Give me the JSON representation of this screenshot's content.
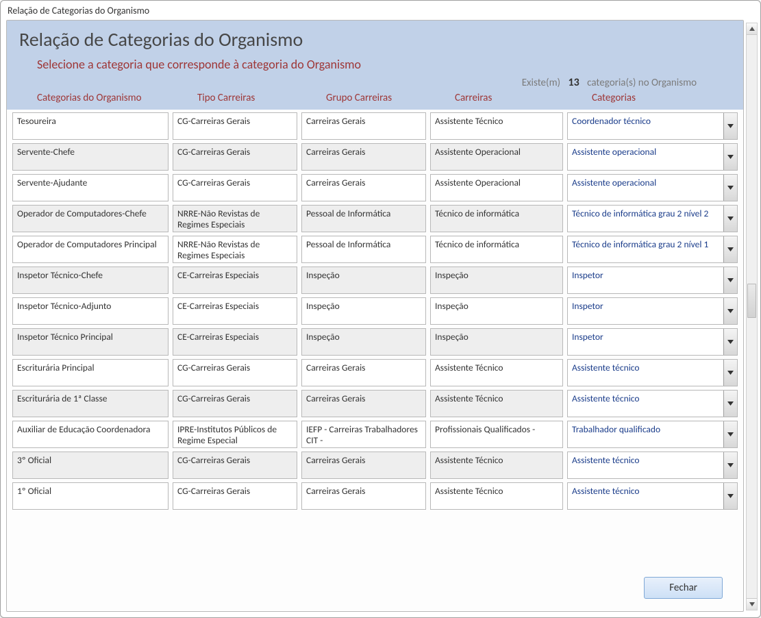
{
  "window_title": "Relação de Categorias do Organismo",
  "page_title": "Relação de Categorias do Organismo",
  "instruction": "Selecione a categoria que corresponde à categoria do Organismo",
  "count_prefix": "Existe(m)",
  "count_value": "13",
  "count_suffix": "categoria(s) no Organismo",
  "columns": {
    "c1": "Categorias do Organismo",
    "c2": "Tipo Carreiras",
    "c3": "Grupo Carreiras",
    "c4": "Carreiras",
    "c5": "Categorias"
  },
  "close_label": "Fechar",
  "rows": [
    {
      "org": "Tesoureira",
      "tipo": "CG-Carreiras Gerais",
      "grupo": "Carreiras Gerais",
      "carr": "Assistente Técnico",
      "cat": "Coordenador técnico",
      "white": true
    },
    {
      "org": "Servente-Chefe",
      "tipo": "CG-Carreiras Gerais",
      "grupo": "Carreiras Gerais",
      "carr": "Assistente Operacional",
      "cat": "Assistente operacional"
    },
    {
      "org": "Servente-Ajudante",
      "tipo": "CG-Carreiras Gerais",
      "grupo": "Carreiras Gerais",
      "carr": "Assistente Operacional",
      "cat": "Assistente operacional",
      "white": true
    },
    {
      "org": "Operador de Computadores-Chefe",
      "tipo": "NRRE-Não Revistas de Regimes Especiais",
      "grupo": "Pessoal de Informática",
      "carr": "Técnico de informática",
      "cat": "Técnico de informática grau 2 nível 2"
    },
    {
      "org": "Operador de Computadores Principal",
      "tipo": "NRRE-Não Revistas de Regimes Especiais",
      "grupo": "Pessoal de Informática",
      "carr": "Técnico de informática",
      "cat": "Técnico de informática grau 2 nível 1",
      "white": true
    },
    {
      "org": "Inspetor Técnico-Chefe",
      "tipo": "CE-Carreiras Especiais",
      "grupo": "Inspeção",
      "carr": "Inspeção",
      "cat": "Inspetor"
    },
    {
      "org": "Inspetor Técnico-Adjunto",
      "tipo": "CE-Carreiras Especiais",
      "grupo": "Inspeção",
      "carr": "Inspeção",
      "cat": "Inspetor",
      "white": true
    },
    {
      "org": "Inspetor Técnico Principal",
      "tipo": "CE-Carreiras Especiais",
      "grupo": "Inspeção",
      "carr": "Inspeção",
      "cat": "Inspetor"
    },
    {
      "org": "Escriturária Principal",
      "tipo": "CG-Carreiras Gerais",
      "grupo": "Carreiras Gerais",
      "carr": "Assistente Técnico",
      "cat": "Assistente técnico",
      "white": true
    },
    {
      "org": "Escriturária de 1ª Classe",
      "tipo": "CG-Carreiras Gerais",
      "grupo": "Carreiras Gerais",
      "carr": "Assistente Técnico",
      "cat": "Assistente técnico"
    },
    {
      "org": "Auxiliar de Educação Coordenadora",
      "tipo": "IPRE-Institutos Públicos de Regime Especial",
      "grupo": "IEFP - Carreiras Trabalhadores CIT -",
      "carr": "Profissionais Qualificados -",
      "cat": "Trabalhador qualificado",
      "white": true
    },
    {
      "org": "3º Oficial",
      "tipo": "CG-Carreiras Gerais",
      "grupo": "Carreiras Gerais",
      "carr": "Assistente Técnico",
      "cat": "Assistente técnico"
    },
    {
      "org": "1º Oficial",
      "tipo": "CG-Carreiras Gerais",
      "grupo": "Carreiras Gerais",
      "carr": "Assistente Técnico",
      "cat": "Assistente técnico",
      "white": true
    }
  ]
}
